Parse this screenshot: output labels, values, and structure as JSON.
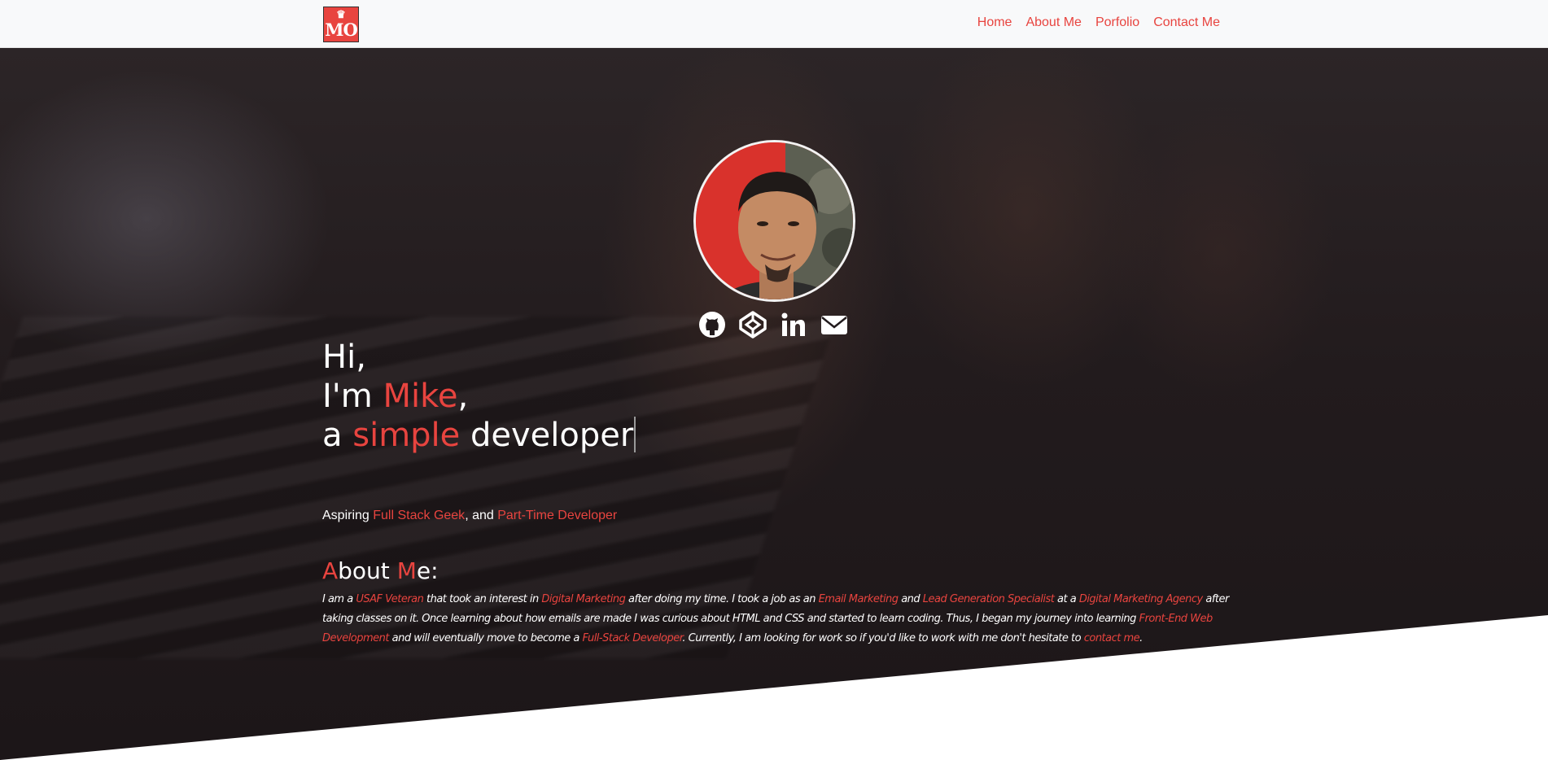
{
  "nav": {
    "brand_text": "MO",
    "brand_crown": "♛",
    "links": [
      "Home",
      "About Me",
      "Porfolio",
      "Contact Me"
    ]
  },
  "social_icons": [
    "github-icon",
    "codepen-icon",
    "linkedin-icon",
    "envelope-icon"
  ],
  "intro": {
    "line1": "Hi,",
    "line2_prefix": "I'm ",
    "line2_name": "Mike",
    "line2_suffix": ",",
    "line3_prefix": "a ",
    "line3_accent": "simple",
    "line3_suffix": " developer"
  },
  "tagline": {
    "prefix": "Aspiring ",
    "role1": "Full Stack Geek",
    "middle": ", and ",
    "role2": "Part-Time Developer"
  },
  "about": {
    "title_a": "A",
    "title_mid": "bout ",
    "title_m": "M",
    "title_end": "e:",
    "p1": "I am a ",
    "h1": "USAF Veteran",
    "p2": " that took an interest in ",
    "h2": "Digital Marketing",
    "p3": " after doing my time. I took a job as an ",
    "h3": "Email Marketing",
    "p4": " and ",
    "h4": "Lead Generation Specialist",
    "p5": " at a ",
    "h5": "Digital Marketing Agency",
    "p6": " after taking classes on it. Once learning about how emails are made I was curious about HTML and CSS and started to learn coding. Thus, I began my journey into learning ",
    "h6": "Front-End Web Development",
    "p7": " and will eventually move to become a ",
    "h7": "Full-Stack Developer",
    "p8": ". Currently, I am looking for work so if you'd like to work with me don't hesitate to ",
    "h8": "contact me",
    "p9": "."
  },
  "colors": {
    "accent": "#e8443f",
    "navbar_bg": "#f8f9fa",
    "hero_bg": "#221b1d",
    "text": "#ffffff"
  }
}
